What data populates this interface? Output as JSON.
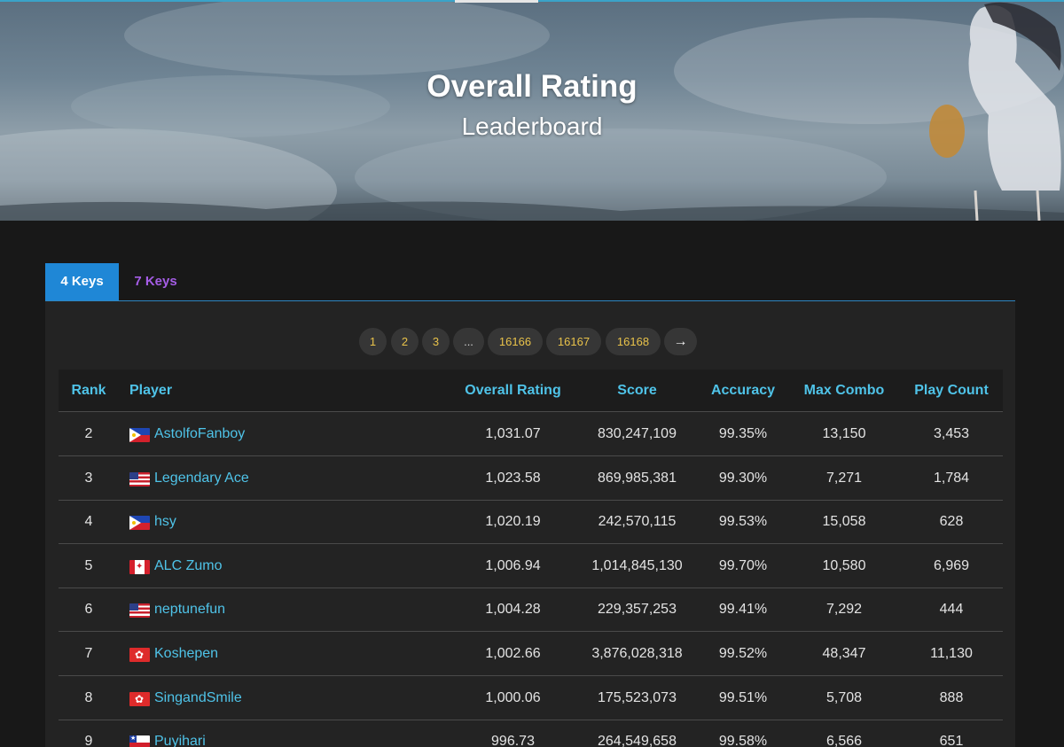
{
  "hero": {
    "title": "Overall Rating",
    "subtitle": "Leaderboard"
  },
  "tabs": [
    {
      "label": "4 Keys",
      "active": true
    },
    {
      "label": "7 Keys",
      "active": false
    }
  ],
  "pagination": {
    "pages": [
      "1",
      "2",
      "3",
      "...",
      "16166",
      "16167",
      "16168"
    ],
    "next_label": "→"
  },
  "table": {
    "columns": [
      "Rank",
      "Player",
      "Overall Rating",
      "Score",
      "Accuracy",
      "Max Combo",
      "Play Count"
    ],
    "rows": [
      {
        "rank": "2",
        "flag": "ph",
        "player": "AstolfoFanboy",
        "rating": "1,031.07",
        "score": "830,247,109",
        "accuracy": "99.35%",
        "combo": "13,150",
        "plays": "3,453"
      },
      {
        "rank": "3",
        "flag": "us",
        "player": "Legendary Ace",
        "rating": "1,023.58",
        "score": "869,985,381",
        "accuracy": "99.30%",
        "combo": "7,271",
        "plays": "1,784"
      },
      {
        "rank": "4",
        "flag": "ph",
        "player": "hsy",
        "rating": "1,020.19",
        "score": "242,570,115",
        "accuracy": "99.53%",
        "combo": "15,058",
        "plays": "628"
      },
      {
        "rank": "5",
        "flag": "ca",
        "player": "ALC Zumo",
        "rating": "1,006.94",
        "score": "1,014,845,130",
        "accuracy": "99.70%",
        "combo": "10,580",
        "plays": "6,969"
      },
      {
        "rank": "6",
        "flag": "us",
        "player": "neptunefun",
        "rating": "1,004.28",
        "score": "229,357,253",
        "accuracy": "99.41%",
        "combo": "7,292",
        "plays": "444"
      },
      {
        "rank": "7",
        "flag": "hk",
        "player": "Koshepen",
        "rating": "1,002.66",
        "score": "3,876,028,318",
        "accuracy": "99.52%",
        "combo": "48,347",
        "plays": "11,130"
      },
      {
        "rank": "8",
        "flag": "hk",
        "player": "SingandSmile",
        "rating": "1,000.06",
        "score": "175,523,073",
        "accuracy": "99.51%",
        "combo": "5,708",
        "plays": "888"
      },
      {
        "rank": "9",
        "flag": "cl",
        "player": "Puyihari",
        "rating": "996.73",
        "score": "264,549,658",
        "accuracy": "99.58%",
        "combo": "6,566",
        "plays": "651"
      }
    ]
  },
  "colors": {
    "accent_blue": "#1f87d6",
    "link_cyan": "#4fc3e8",
    "tab_inactive_purple": "#a55de6",
    "page_number_gold": "#e8c24a"
  }
}
